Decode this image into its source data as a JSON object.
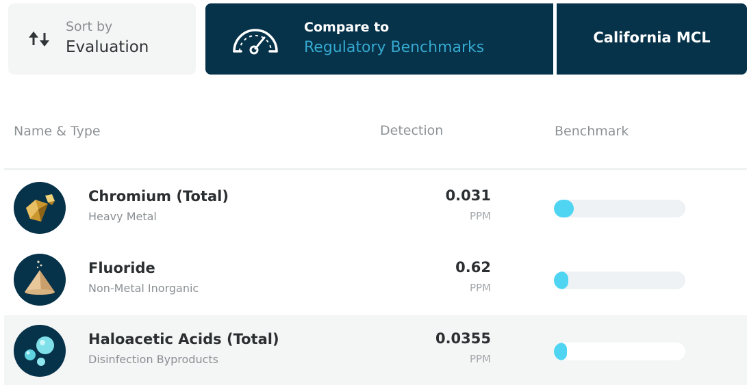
{
  "toolbar": {
    "sort": {
      "label": "Sort by",
      "value": "Evaluation",
      "icon": "sort-arrows-icon"
    },
    "compare": {
      "label": "Compare to",
      "value": "Regulatory Benchmarks",
      "icon": "gauge-icon"
    },
    "benchmark_selector": {
      "value": "California MCL"
    }
  },
  "table": {
    "headers": {
      "name": "Name & Type",
      "detection": "Detection",
      "benchmark": "Benchmark"
    },
    "rows": [
      {
        "name": "Chromium (Total)",
        "type": "Heavy Metal",
        "detection": "0.031",
        "unit": "PPM",
        "icon": "chromium-crystal-icon",
        "benchmark_fraction": 0.15
      },
      {
        "name": "Fluoride",
        "type": "Non-Metal Inorganic",
        "detection": "0.62",
        "unit": "PPM",
        "icon": "fluoride-powder-icon",
        "benchmark_fraction": 0.11
      },
      {
        "name": "Haloacetic Acids (Total)",
        "type": "Disinfection Byproducts",
        "detection": "0.0355",
        "unit": "PPM",
        "icon": "haloacetic-bubbles-icon",
        "benchmark_fraction": 0.1
      }
    ]
  },
  "colors": {
    "navy": "#06324a",
    "accent": "#35a9cf",
    "bar_fill": "#4fd4f2",
    "bar_track": "#eef2f5"
  }
}
